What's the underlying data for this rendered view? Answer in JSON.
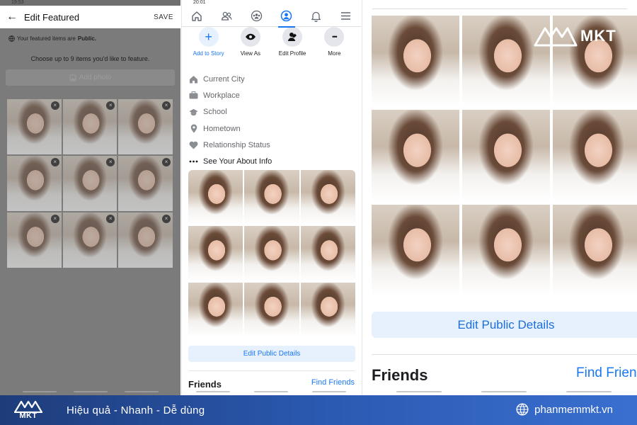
{
  "left": {
    "status_time": "19:53",
    "back_glyph": "←",
    "title": "Edit Featured",
    "save_label": "SAVE",
    "public_prefix": "Your featured items are",
    "public_word": "Public.",
    "choose_text": "Choose up to 9 items you'd like to feature.",
    "add_photo_label": "Add photo",
    "remove_glyph": "×"
  },
  "middle": {
    "status_time": "20:01",
    "actions": [
      {
        "label": "Add to Story",
        "glyph": "+"
      },
      {
        "label": "View As",
        "glyph": "👁"
      },
      {
        "label": "Edit Profile",
        "glyph": ""
      },
      {
        "label": "More",
        "glyph": "•••"
      }
    ],
    "about": [
      {
        "label": "Current City",
        "icon": "house-icon"
      },
      {
        "label": "Workplace",
        "icon": "briefcase-icon"
      },
      {
        "label": "School",
        "icon": "graduation-cap-icon"
      },
      {
        "label": "Hometown",
        "icon": "location-pin-icon"
      },
      {
        "label": "Relationship Status",
        "icon": "heart-icon"
      },
      {
        "label": "See Your About Info",
        "icon": "ellipsis-icon"
      }
    ],
    "edit_public_details": "Edit Public Details",
    "friends_title": "Friends",
    "find_friends": "Find Friends"
  },
  "right": {
    "brand": "MKT",
    "edit_public_details": "Edit Public Details",
    "friends_title": "Friends",
    "find_friends": "Find Frien"
  },
  "footer": {
    "brand": "MKT",
    "tagline": "Hiệu quả - Nhanh - Dễ dùng",
    "site": "phanmemmkt.vn"
  },
  "colors": {
    "facebook_blue": "#1877f2",
    "light_blue_button": "#e7f0fd",
    "footer_start": "#1e3c7a",
    "footer_end": "#3a6fd0"
  }
}
